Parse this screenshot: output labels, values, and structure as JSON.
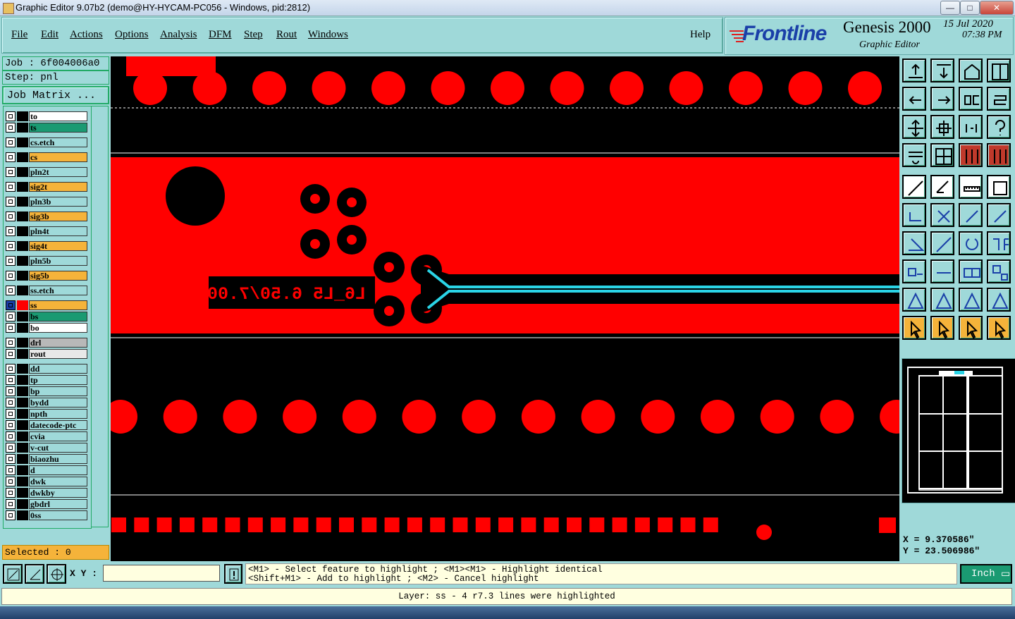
{
  "window": {
    "title": "Graphic Editor 9.07b2 (demo@HY-HYCAM-PC056 - Windows, pid:2812)",
    "controls": {
      "minimize": "—",
      "maximize": "□",
      "close": "✕"
    }
  },
  "menu": {
    "items": [
      "File",
      "Edit",
      "Actions",
      "Options",
      "Analysis",
      "DFM",
      "Step",
      "Rout",
      "Windows"
    ],
    "help": "Help"
  },
  "brand": {
    "logo": "Frontline",
    "product": "Genesis 2000",
    "subtitle": "Graphic Editor",
    "date": "15 Jul 2020",
    "time": "07:38 PM"
  },
  "job": {
    "job_label": "Job : 6f004006a0",
    "step_label": "Step: pnl",
    "matrix_button": "Job Matrix ..."
  },
  "layers": [
    {
      "name": "to",
      "color": "#ffffff"
    },
    {
      "name": "ts",
      "color": "#1a9a72"
    },
    {
      "name": "cs.etch",
      "color": "#9fd9d9"
    },
    {
      "name": "cs",
      "color": "#f5b33a"
    },
    {
      "name": "pln2t",
      "color": "#9fd9d9"
    },
    {
      "name": "sig2t",
      "color": "#f5b33a"
    },
    {
      "name": "pln3b",
      "color": "#9fd9d9"
    },
    {
      "name": "sig3b",
      "color": "#f5b33a"
    },
    {
      "name": "pln4t",
      "color": "#9fd9d9"
    },
    {
      "name": "sig4t",
      "color": "#f5b33a"
    },
    {
      "name": "pln5b",
      "color": "#9fd9d9"
    },
    {
      "name": "sig5b",
      "color": "#f5b33a"
    },
    {
      "name": "ss.etch",
      "color": "#9fd9d9"
    },
    {
      "name": "ss",
      "color": "#f5b33a"
    },
    {
      "name": "bs",
      "color": "#1a9a72"
    },
    {
      "name": "bo",
      "color": "#ffffff"
    },
    {
      "name": "drl",
      "color": "#b8b8b8"
    },
    {
      "name": "rout",
      "color": "#e8e8e8"
    },
    {
      "name": "dd",
      "color": "#9fd9d9"
    },
    {
      "name": "tp",
      "color": "#9fd9d9"
    },
    {
      "name": "bp",
      "color": "#9fd9d9"
    },
    {
      "name": "bydd",
      "color": "#9fd9d9"
    },
    {
      "name": "npth",
      "color": "#9fd9d9"
    },
    {
      "name": "datecode-ptc",
      "color": "#9fd9d9"
    },
    {
      "name": "cvia",
      "color": "#9fd9d9"
    },
    {
      "name": "v-cut",
      "color": "#9fd9d9"
    },
    {
      "name": "biaozhu",
      "color": "#9fd9d9"
    },
    {
      "name": "d",
      "color": "#9fd9d9"
    },
    {
      "name": "dwk",
      "color": "#9fd9d9"
    },
    {
      "name": "dwkby",
      "color": "#9fd9d9"
    },
    {
      "name": "gbdrl",
      "color": "#9fd9d9"
    },
    {
      "name": "0ss",
      "color": "#9fd9d9"
    }
  ],
  "selected": "Selected : 0",
  "canvas": {
    "mirrored_text": "L6_L5 6.50/7.00 ‡",
    "colors": {
      "copper": "#ff0000",
      "background": "#000000",
      "highlight": "#2ad4e6",
      "outline": "#ffffff"
    }
  },
  "coords": {
    "x": "X = 9.370586\"",
    "y": "Y = 23.506986\""
  },
  "bottom": {
    "xy_label": "X Y :",
    "xy_placeholder": "",
    "hint_line1": "<M1> - Select feature to highlight ; <M1><M1> - Highlight identical",
    "hint_line2": "<Shift+M1> - Add to highlight ; <M2> - Cancel highlight",
    "units": "Inch",
    "status": "Layer: ss - 4 r7.3 lines were highlighted"
  },
  "tool_icons": [
    "zoom-home-icon",
    "zoom-fit-icon",
    "home-view-icon",
    "window-split-icon",
    "pan-left-icon",
    "pan-right-icon",
    "mirror-icon",
    "redraw-icon",
    "zoom-in-icon",
    "zoom-out-icon",
    "zoom-one-to-two-icon",
    "help-icon",
    "settings-icon",
    "grid-icon",
    "layers-a-icon",
    "layers-b-icon",
    "pad-icon",
    "line-icon",
    "ruler-icon",
    "outline-icon",
    "node-icon",
    "snap-icon",
    "connect-icon",
    "connect-alt-icon",
    "angle-icon",
    "segment-icon",
    "arc-icon",
    "split-icon",
    "select-feature-icon",
    "cut-icon",
    "measure-icon",
    "copy-shape-icon",
    "triangle-a-icon",
    "triangle-b-icon",
    "triangle-c-icon",
    "triangle-d-icon",
    "pointer-icon",
    "pointer-box-icon",
    "pointer-circle-icon",
    "pointer-multi-icon"
  ]
}
